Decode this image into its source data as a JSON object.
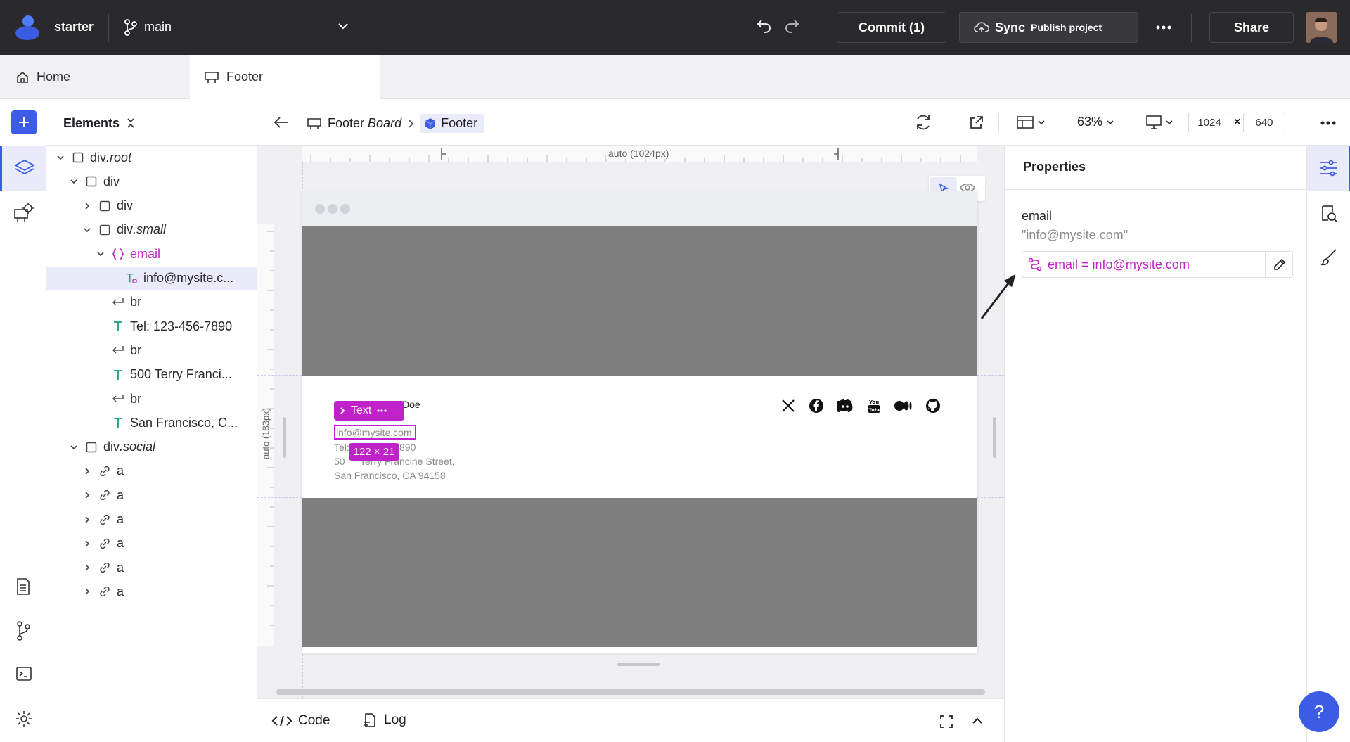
{
  "topbar": {
    "project_name": "starter",
    "branch_name": "main",
    "commit_label": "Commit (1)",
    "sync_label": "Sync",
    "publish_label": "Publish project",
    "share_label": "Share"
  },
  "tabs": [
    {
      "label": "Home",
      "icon": "home-icon"
    },
    {
      "label": "Footer",
      "icon": "board-icon"
    }
  ],
  "elements_panel": {
    "title": "Elements",
    "tree": [
      {
        "label": "div",
        "cls": ".root",
        "depth": 0,
        "chevron": "down",
        "icon": "box"
      },
      {
        "label": "div",
        "cls": "",
        "depth": 1,
        "chevron": "down",
        "icon": "box"
      },
      {
        "label": "div",
        "cls": "",
        "depth": 2,
        "chevron": "right",
        "icon": "box"
      },
      {
        "label": "div",
        "cls": ".small",
        "depth": 2,
        "chevron": "down",
        "icon": "box"
      },
      {
        "label": "email",
        "cls": "",
        "depth": 3,
        "chevron": "down",
        "icon": "braces"
      },
      {
        "label": "info@mysite.c...",
        "cls": "",
        "depth": 4,
        "chevron": "",
        "icon": "text-bound",
        "selected": true
      },
      {
        "label": "br",
        "cls": "",
        "depth": 3,
        "chevron": "",
        "icon": "br"
      },
      {
        "label": "Tel: 123-456-7890",
        "cls": "",
        "depth": 3,
        "chevron": "",
        "icon": "text"
      },
      {
        "label": "br",
        "cls": "",
        "depth": 3,
        "chevron": "",
        "icon": "br"
      },
      {
        "label": "500 Terry Franci...",
        "cls": "",
        "depth": 3,
        "chevron": "",
        "icon": "text"
      },
      {
        "label": "br",
        "cls": "",
        "depth": 3,
        "chevron": "",
        "icon": "br"
      },
      {
        "label": "San Francisco, C...",
        "cls": "",
        "depth": 3,
        "chevron": "",
        "icon": "text"
      },
      {
        "label": "div",
        "cls": ".social",
        "depth": 1,
        "chevron": "down",
        "icon": "box"
      },
      {
        "label": "a",
        "cls": "",
        "depth": 2,
        "chevron": "right",
        "icon": "link"
      },
      {
        "label": "a",
        "cls": "",
        "depth": 2,
        "chevron": "right",
        "icon": "link"
      },
      {
        "label": "a",
        "cls": "",
        "depth": 2,
        "chevron": "right",
        "icon": "link"
      },
      {
        "label": "a",
        "cls": "",
        "depth": 2,
        "chevron": "right",
        "icon": "link"
      },
      {
        "label": "a",
        "cls": "",
        "depth": 2,
        "chevron": "right",
        "icon": "link"
      },
      {
        "label": "a",
        "cls": "",
        "depth": 2,
        "chevron": "right",
        "icon": "link"
      }
    ]
  },
  "editor": {
    "breadcrumb_board": "Footer",
    "breadcrumb_board_suffix": "Board",
    "breadcrumb_component": "Footer",
    "zoom": "63%",
    "width": "1024",
    "height": "640",
    "times": "×",
    "ruler_top": "auto (1024px)",
    "ruler_left": "auto (183px)"
  },
  "footer_preview": {
    "name_fragment": "Doe",
    "email": "info@mysite.com",
    "tel_prefix": "Tel:",
    "tel_fragment": "890",
    "address_line1_prefix": "50",
    "address_line1": "Terry Francine Street,",
    "address_line2": "San Francisco, CA 94158",
    "selection_badge": "Text",
    "size_badge": "122 × 21",
    "social_icons": [
      "x-icon",
      "facebook-icon",
      "discord-icon",
      "youtube-icon",
      "medium-icon",
      "github-icon"
    ]
  },
  "bottom_bar": {
    "code_label": "Code",
    "log_label": "Log"
  },
  "properties": {
    "title": "Properties",
    "field_label": "email",
    "field_value": "\"info@mysite.com\"",
    "binding": "email = info@mysite.com"
  },
  "colors": {
    "accent": "#3d5ce6",
    "bound_text": "#c021c9",
    "topbar": "#2a2a2d"
  }
}
